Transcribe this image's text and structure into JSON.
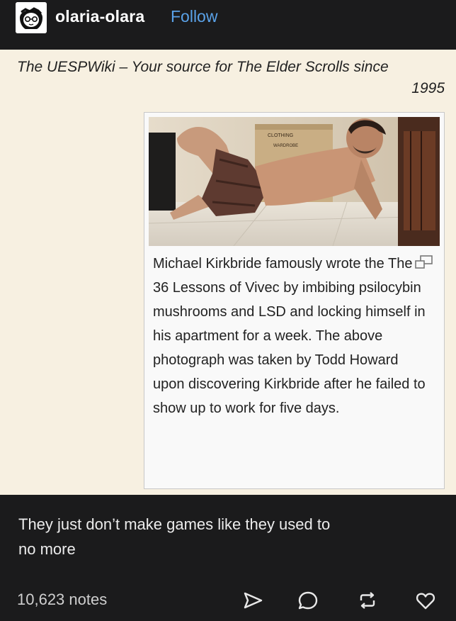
{
  "header": {
    "username": "olaria-olara",
    "follow_label": "Follow"
  },
  "post_image": {
    "headline_line1": "The UESPWiki – Your source for The Elder Scrolls since",
    "headline_line2": "1995",
    "photo_box_text_line1": "CLOTHING",
    "photo_box_text_line2": "WARDROBE",
    "caption": "Michael Kirkbride famously wrote the The 36 Lessons of Vivec by imbibing psilocybin mushrooms and LSD and locking himself in his apartment for a week. The above photograph was taken by Todd Howard upon discovering Kirkbride after he failed to show up to work for five days."
  },
  "post": {
    "body_line1": "They just don’t make games like they used to",
    "body_line2": "no more"
  },
  "footer": {
    "notes": "10,623 notes",
    "icons": [
      "share-icon",
      "reply-icon",
      "reblog-icon",
      "like-icon"
    ]
  },
  "colors": {
    "background": "#1b1b1c",
    "follow": "#5aa2e8",
    "post_image_bg": "#f7f0e1",
    "icon": "#e8e8e8"
  }
}
